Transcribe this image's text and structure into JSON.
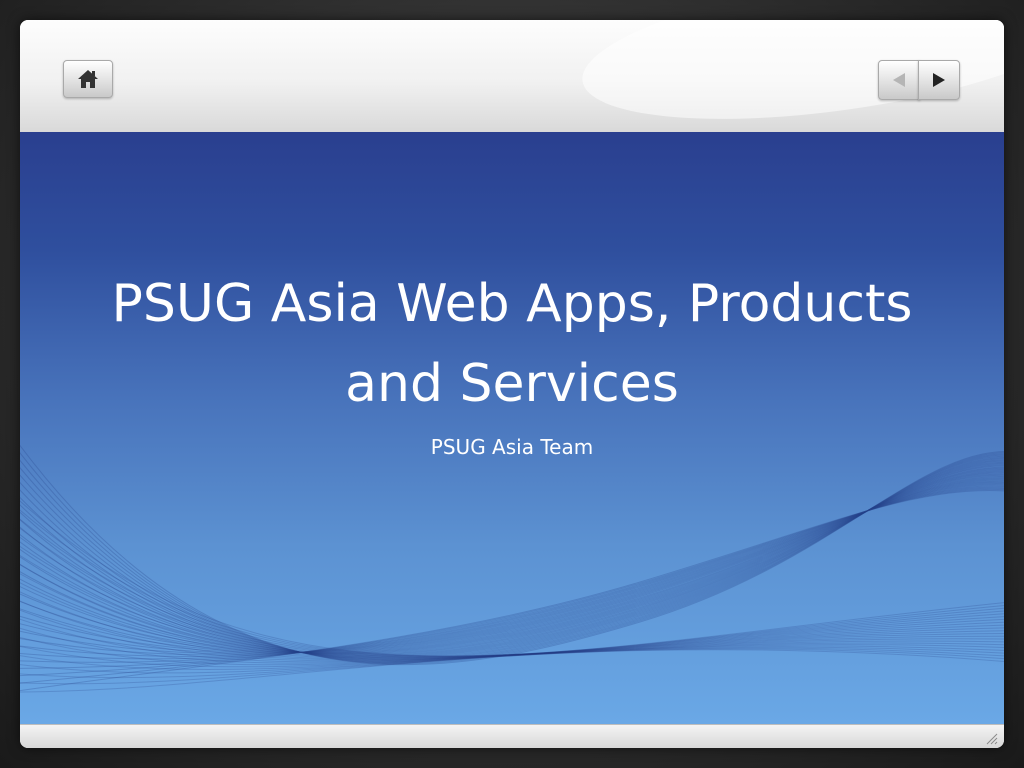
{
  "slide": {
    "title": "PSUG Asia Web Apps, Products and Services",
    "subtitle": "PSUG Asia Team"
  },
  "toolbar": {
    "home_icon": "home-icon",
    "prev_icon": "triangle-left-icon",
    "next_icon": "triangle-right-icon"
  },
  "colors": {
    "slide_top": "#2a3f8f",
    "slide_bottom": "#6aa8e6",
    "title_text": "#ffffff"
  }
}
